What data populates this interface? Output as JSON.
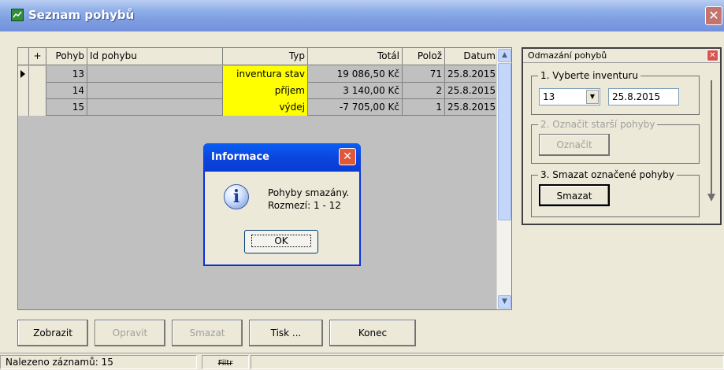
{
  "window": {
    "title": "Seznam pohybů",
    "icon": "app-icon",
    "close_icon": "close-icon"
  },
  "grid": {
    "columns": [
      "+",
      "Pohyb",
      "Id pohybu",
      "Typ",
      "Totál",
      "Polož",
      "Datum"
    ],
    "rows": [
      {
        "pohyb": "13",
        "id": "",
        "typ": "inventura stav",
        "total": "19 086,50 Kč",
        "poloz": "71",
        "datum": "25.8.2015",
        "current": true
      },
      {
        "pohyb": "14",
        "id": "",
        "typ": "příjem",
        "total": "3 140,00 Kč",
        "poloz": "2",
        "datum": "25.8.2015",
        "current": false
      },
      {
        "pohyb": "15",
        "id": "",
        "typ": "výdej",
        "total": "-7 705,00 Kč",
        "poloz": "1",
        "datum": "25.8.2015",
        "current": false
      }
    ],
    "typ_highlight_color": "#ffff00"
  },
  "msgbox": {
    "title": "Informace",
    "line1": "Pohyby smazány.",
    "line2": "Rozmezí: 1 - 12",
    "ok_label": "OK",
    "icon": "info-icon"
  },
  "panel": {
    "title": "Odmazání pohybů",
    "group1_label": "1. Vyberte inventuru",
    "combo_value": "13",
    "date_value": "25.8.2015",
    "group2_label": "2. Označit starší pohyby",
    "mark_button": "Označit",
    "group3_label": "3. Smazat označené pohyby",
    "delete_button": "Smazat"
  },
  "buttons": {
    "show": "Zobrazit",
    "edit": "Opravit",
    "delete": "Smazat",
    "print": "Tisk ...",
    "end": "Konec"
  },
  "status": {
    "found": "Nalezeno záznamů: 15",
    "filter": "Filtr"
  },
  "colors": {
    "titlebar": "#7f9fe2",
    "msgbox_title": "#0a46dd",
    "background": "#ece9d8",
    "grid_background": "#c0c0c0"
  }
}
